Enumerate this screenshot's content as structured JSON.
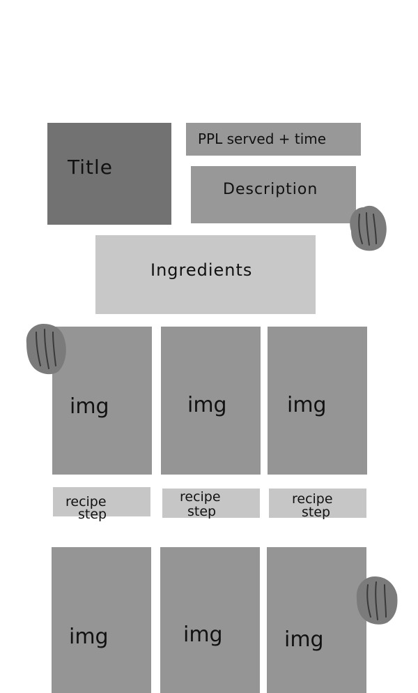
{
  "colors": {
    "title_fill": "#727272",
    "info_fill": "#989898",
    "ingredients_fill": "#c8c8c8",
    "image_fill": "#959595",
    "step_fill": "#c6c6c6",
    "leaf_fill": "#7b7b7b",
    "text": "#111111"
  },
  "header": {
    "title": "Title",
    "served_time": "PPL served + time",
    "description": "Description"
  },
  "ingredients": {
    "label": "Ingredients"
  },
  "gallery": {
    "rows": [
      {
        "images": [
          "img",
          "img",
          "img"
        ],
        "steps": [
          [
            "recipe",
            "step"
          ],
          [
            "recipe",
            "step"
          ],
          [
            "recipe",
            "step"
          ]
        ]
      },
      {
        "images": [
          "img",
          "img",
          "img"
        ]
      }
    ]
  },
  "decorations": {
    "icon": "leaf-icon"
  }
}
